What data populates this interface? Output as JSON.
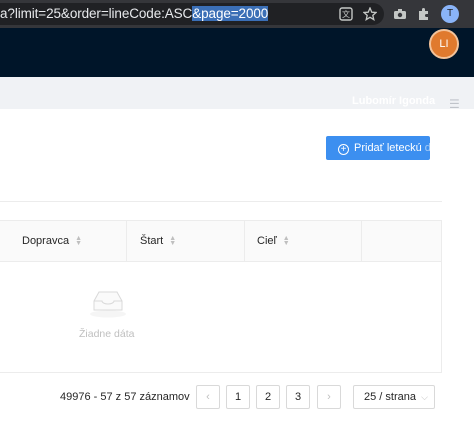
{
  "browser": {
    "url_prefix": "a?limit=25&order=lineCode:ASC",
    "url_selected": "&page=2000",
    "profile_initial": "T"
  },
  "header": {
    "avatar_initials": "LI"
  },
  "subheader": {
    "user_name": "Lubomír Igonda"
  },
  "toolbar": {
    "add_button_label": "Pridať leteckú ",
    "add_button_label_faded": "dopravu"
  },
  "table": {
    "columns": [
      {
        "label": "Dopravca"
      },
      {
        "label": "Štart"
      },
      {
        "label": "Cieľ"
      }
    ],
    "empty_text": "Žiadne dáta"
  },
  "pagination": {
    "total_text": "49976 - 57 z 57 záznamov",
    "pages": [
      "1",
      "2",
      "3"
    ],
    "page_size_label": "25 / strana"
  }
}
